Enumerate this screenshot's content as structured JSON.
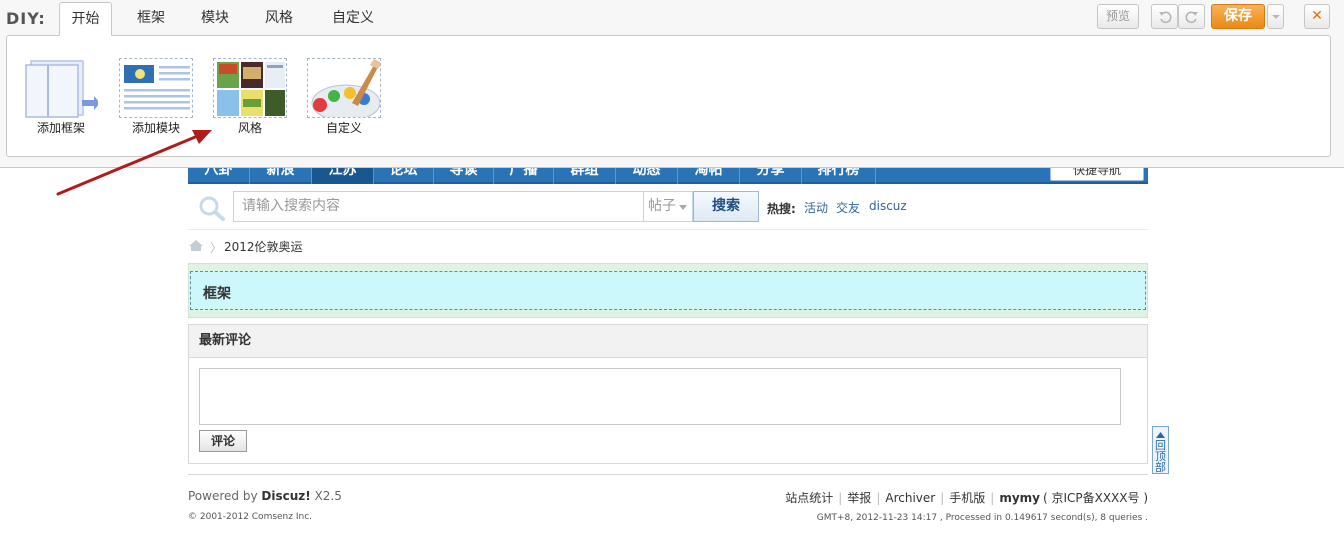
{
  "diy": {
    "label": "DIY:",
    "tabs": [
      "开始",
      "框架",
      "模块",
      "风格",
      "自定义"
    ],
    "active_tab": "开始",
    "items": [
      {
        "label": "添加框架",
        "icon": "add-frame-icon"
      },
      {
        "label": "添加模块",
        "icon": "add-module-icon"
      },
      {
        "label": "风格",
        "icon": "style-thumbnail-icon"
      },
      {
        "label": "自定义",
        "icon": "palette-brush-icon"
      }
    ],
    "preview_label": "预览",
    "save_label": "保存",
    "close_glyph": "✕"
  },
  "nav": {
    "items": [
      "八卦",
      "新浪",
      "江苏",
      "论坛",
      "导读",
      "广播",
      "群组",
      "动态",
      "淘帖",
      "分享",
      "排行榜"
    ],
    "active_index": 2,
    "quick_nav": "快捷导航"
  },
  "search": {
    "placeholder": "请输入搜索内容",
    "type_label": "帖子",
    "button_label": "搜索",
    "hot_label": "热搜:",
    "hot_terms": [
      "活动",
      "交友",
      "discuz"
    ]
  },
  "breadcrumb": {
    "separator": "〉",
    "current": "2012伦敦奥运"
  },
  "frame": {
    "label": "框架"
  },
  "comments": {
    "title": "最新评论",
    "button_label": "评论"
  },
  "back_to_top": "回顶部",
  "footer": {
    "powered_prefix": "Powered by ",
    "powered_brand": "Discuz!",
    "powered_version": " X2.5",
    "copyright": "© 2001-2012 Comsenz Inc.",
    "links": [
      "站点统计",
      "举报",
      "Archiver",
      "手机版"
    ],
    "site_name": "mymy",
    "icp": "( 京ICP备XXXX号 )",
    "gmt_text": "GMT+8, 2012-11-23 14:17 , Processed in 0.149617 second(s), 8 queries ."
  },
  "colors": {
    "nav_blue": "#2b73b7",
    "save_orange": "#e98a14",
    "frame_cyan": "#ccf7fb",
    "arrow_red": "#b01c1c"
  }
}
